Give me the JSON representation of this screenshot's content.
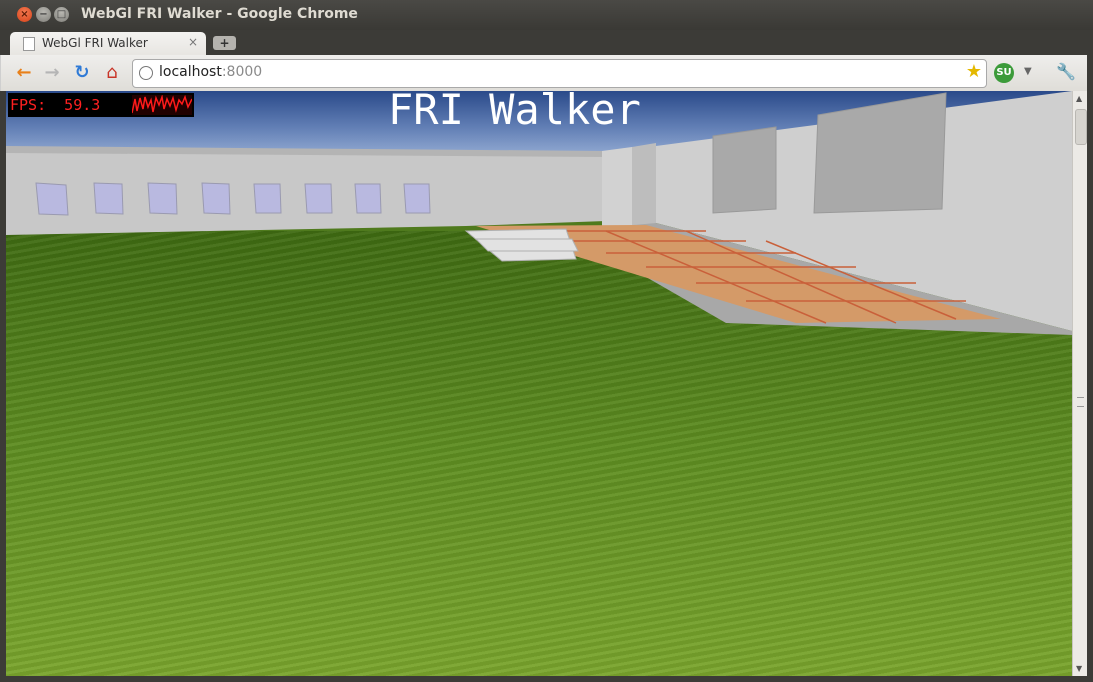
{
  "window": {
    "title": "WebGl FRI Walker - Google Chrome",
    "close_glyph": "×",
    "minimize_glyph": "−",
    "maximize_glyph": "□"
  },
  "tabs": [
    {
      "label": "WebGl FRI Walker",
      "close_glyph": "×",
      "active": true
    }
  ],
  "new_tab_glyph": "+",
  "toolbar": {
    "back_icon": "arrow-left-icon",
    "forward_icon": "arrow-right-icon",
    "reload_icon": "reload-icon",
    "home_icon": "home-icon",
    "url_host": "localhost",
    "url_port": ":8000",
    "bookmark_icon": "star-icon",
    "extension_icon": "stumbleupon-icon",
    "extension_label": "SU",
    "menu_icon": "wrench-icon"
  },
  "content": {
    "fps_label": "FPS:  59.3",
    "heading": "FRI Walker"
  },
  "colors": {
    "fps_text": "#ff2020",
    "sky": "#3c5fa0",
    "grass": "#5f8e22",
    "wall": "#c9c9c9",
    "path": "#d99a6a"
  }
}
